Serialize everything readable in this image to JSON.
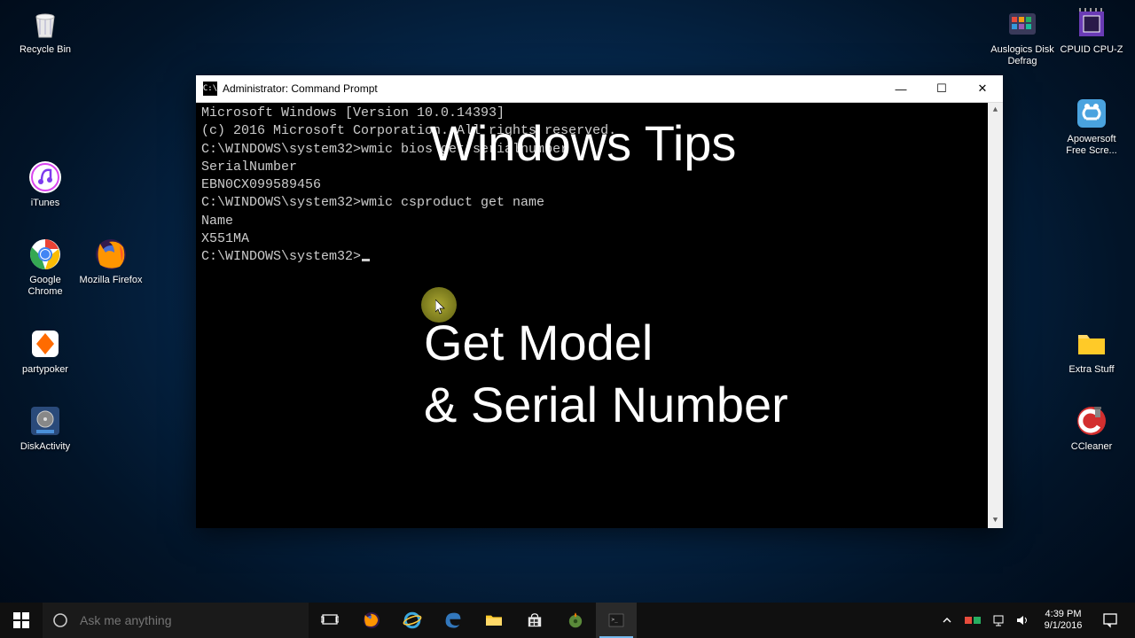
{
  "desktop": {
    "icons_left": [
      {
        "id": "recycle-bin",
        "label": "Recycle Bin"
      },
      {
        "id": "itunes",
        "label": "iTunes"
      },
      {
        "id": "chrome",
        "label": "Google Chrome"
      },
      {
        "id": "firefox",
        "label": "Mozilla Firefox"
      },
      {
        "id": "partypoker",
        "label": "partypoker"
      },
      {
        "id": "diskactivity",
        "label": "DiskActivity"
      }
    ],
    "icons_right": [
      {
        "id": "auslogics",
        "label": "Auslogics Disk Defrag"
      },
      {
        "id": "cpuz",
        "label": "CPUID CPU-Z"
      },
      {
        "id": "apowersoft",
        "label": "Apowersoft Free Scre..."
      },
      {
        "id": "extra-stuff",
        "label": "Extra Stuff"
      },
      {
        "id": "ccleaner",
        "label": "CCleaner"
      }
    ]
  },
  "cmd": {
    "title": "Administrator: Command Prompt",
    "lines": [
      "Microsoft Windows [Version 10.0.14393]",
      "(c) 2016 Microsoft Corporation. All rights reserved.",
      "",
      "C:\\WINDOWS\\system32>wmic bios get serialnumber",
      "SerialNumber",
      "EBN0CX099589456",
      "",
      "C:\\WINDOWS\\system32>wmic csproduct get name",
      "Name",
      "X551MA",
      "",
      ""
    ],
    "prompt": "C:\\WINDOWS\\system32>"
  },
  "overlay": {
    "line1": "Windows Tips",
    "line2": "Get Model",
    "line3": "& Serial Number"
  },
  "taskbar": {
    "search_placeholder": "Ask me anything",
    "time": "4:39 PM",
    "date": "9/1/2016"
  }
}
